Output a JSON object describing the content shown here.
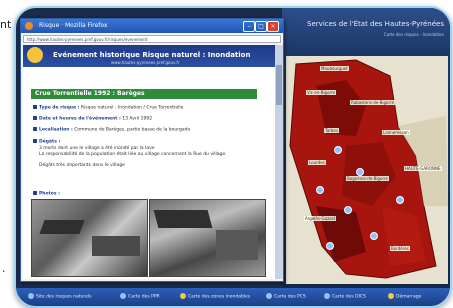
{
  "outside": {
    "left_top_text": "nt",
    "bottom_left_text": "."
  },
  "browser": {
    "title": "Risque · Mozilla Firefox",
    "address": "http://www.hautes-pyrenees.pref.gouv.fr/risques/evenement",
    "banner_title": "Evénement historique Risque naturel : Inondation",
    "banner_url": "www.hautes-pyrenees.pref.gouv.fr",
    "event_title": "Crue Torrentielle 1992 : Barèges",
    "fields": [
      {
        "label": "Type de risque :",
        "value": "Risque naturel - Inondation / Crue Torrentielle"
      },
      {
        "label": "Date et heures de l'événement :",
        "value": "13 Avril 1992"
      },
      {
        "label": "Localisation :",
        "value": "Commune de Barèges, partie basse de la bourgade"
      },
      {
        "label": "Dégâts :",
        "value": "3 morts dont une le village a été inondé par la lave"
      },
      {
        "label": "",
        "value": "La responsabilité de la population était liée au village concernant la Rue du village."
      },
      {
        "label": "",
        "value": "Dégâts très importants dans le village"
      }
    ],
    "photos_label": "Photos :"
  },
  "map_app": {
    "title": "Services de l'État des Hautes-Pyrénées",
    "subtitle": "Carte des risques - Inondation",
    "labels": [
      "Maubourguet",
      "Vic-en-Bigorre",
      "Rabastens-de-Bigorre",
      "Tarbes",
      "Lannemezan",
      "Bagnères-de-Bigorre",
      "Lourdes",
      "Argelès-Gazost",
      "HAUTE-GARONNE",
      "Bordères"
    ]
  },
  "taskbar": {
    "items": [
      "Site des risques naturels",
      "Carte des PPR",
      "Carte des zones inondables",
      "Carte des PCS",
      "Carte des DICS",
      "Démarrage"
    ]
  }
}
